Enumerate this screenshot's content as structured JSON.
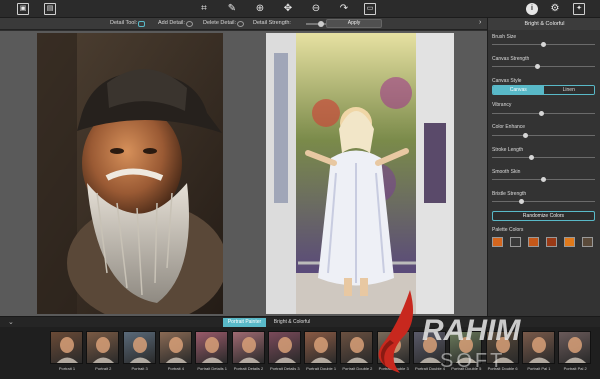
{
  "toolbar": {
    "icons": [
      "image-icon",
      "gallery-icon",
      "crop-icon",
      "brush-icon",
      "zoom-in-icon",
      "fit-icon",
      "zoom-out-icon",
      "redo-icon",
      "export-icon",
      "info-icon",
      "settings-icon",
      "social-icon"
    ]
  },
  "subbar": {
    "detail_tool": "Detail Tool:",
    "add_detail": "Add Detail:",
    "delete_detail": "Delete Detail:",
    "detail_strength": "Detail Strength:",
    "apply": "Apply"
  },
  "panel": {
    "title": "Bright & Colorful",
    "brush_size": {
      "label": "Brush Size",
      "value": 0.5
    },
    "canvas_strength": {
      "label": "Canvas Strength",
      "value": 0.44
    },
    "canvas_style": {
      "label": "Canvas Style",
      "options": [
        "Canvas",
        "Linen"
      ],
      "selected": "Canvas"
    },
    "vibrancy": {
      "label": "Vibrancy",
      "value": 0.48
    },
    "color_enhance": {
      "label": "Color Enhance",
      "value": 0.32
    },
    "stroke_length": {
      "label": "Stroke Length",
      "value": 0.38
    },
    "smooth_skin": {
      "label": "Smooth Skin",
      "value": 0.5
    },
    "bristle_strength": {
      "label": "Bristle Strength",
      "value": 0.28
    },
    "randomize": "Randomize Colors",
    "palette_label": "Palette Colors",
    "palette": [
      "#d4661e",
      "#3a3a3a",
      "#c4581a",
      "#9a3a16",
      "#e07a1c",
      "#5a4a3a"
    ]
  },
  "tabs": {
    "portrait_painter": "Portrait Painter",
    "bright_colorful": "Bright & Colorful"
  },
  "thumbs": [
    "Portrait 1",
    "Portrait 2",
    "Portrait 3",
    "Portrait 4",
    "Portrait Details 1",
    "Portrait Details 2",
    "Portrait Details 3",
    "Portrait Double 1",
    "Portrait Double 2",
    "Portrait Double 3",
    "Portrait Double 4",
    "Portrait Double 5",
    "Portrait Double 6",
    "Portrait Pal 1",
    "Portrait Pal 2"
  ],
  "watermark": {
    "brand": "RAHIM",
    "sub": "SOFT"
  },
  "colors": {
    "accent": "#59b9c8"
  }
}
